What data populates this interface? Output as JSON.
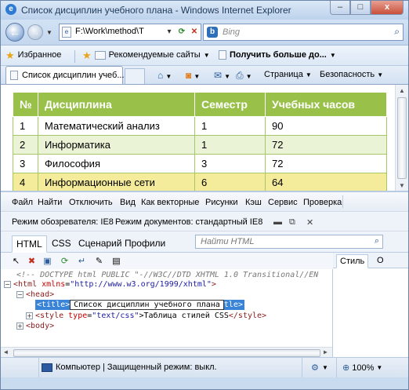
{
  "window": {
    "title": "Список дисциплин учебного плана - Windows Internet Explorer",
    "minimize_label": "–",
    "maximize_label": "□",
    "close_label": "x"
  },
  "nav": {
    "address": "F:\\Work\\method\\T",
    "search_placeholder": "Bing"
  },
  "favorites": {
    "favorites_label": "Избранное",
    "suggested_label": "Рекомендуемые сайты",
    "get_more_label": "Получить больше до..."
  },
  "tab": {
    "label": "Список дисциплин учеб..."
  },
  "commandbar": {
    "page_label": "Страница",
    "safety_label": "Безопасность"
  },
  "table": {
    "headers": [
      "№",
      "Дисциплина",
      "Семестр",
      "Учебных часов"
    ],
    "rows": [
      [
        "1",
        "Математический анализ",
        "1",
        "90"
      ],
      [
        "2",
        "Информатика",
        "1",
        "72"
      ],
      [
        "3",
        "Философия",
        "3",
        "72"
      ],
      [
        "4",
        "Информационные сети",
        "6",
        "64"
      ]
    ]
  },
  "devtools": {
    "menu": [
      "Файл",
      "Найти",
      "Отключить",
      "Вид",
      "Как векторные",
      "Рисунки",
      "Кэш",
      "Сервис",
      "Проверка"
    ],
    "browser_mode": "Режим обозревателя:  IE8",
    "document_mode": "Режим документов:  стандартный IE8",
    "tabs": [
      "HTML",
      "CSS",
      "Сценарий",
      "Профили"
    ],
    "find_placeholder": "Найти HTML",
    "style_tab": "Стиль",
    "style_tab2": "О",
    "tree": {
      "doctype": "<!-- DOCTYPE html PUBLIC \"-//W3C//DTD XHTML 1.0 Transitional//EN",
      "html_open": "<html",
      "html_attr": "xmlns",
      "html_val": "\"http://www.w3.org/1999/xhtml\"",
      "head_open": "<head>",
      "title_open": "<title>",
      "title_edit": "Список дисциплин учебного плана",
      "title_close": "tle>",
      "style_open": "<style",
      "style_attr": "type",
      "style_val": "\"text/css\"",
      "style_text": ">Таблица стилей CSS",
      "style_close": "</style>",
      "body_open": "<body>"
    }
  },
  "status": {
    "zone": "Компьютер | Защищенный режим: выкл.",
    "zoom": "100%"
  },
  "colors": {
    "table_header": "#99c14a",
    "table_alt_row": "#eaf3d6",
    "table_selected_row": "#f4eb9b",
    "selection": "#3a84d8"
  }
}
